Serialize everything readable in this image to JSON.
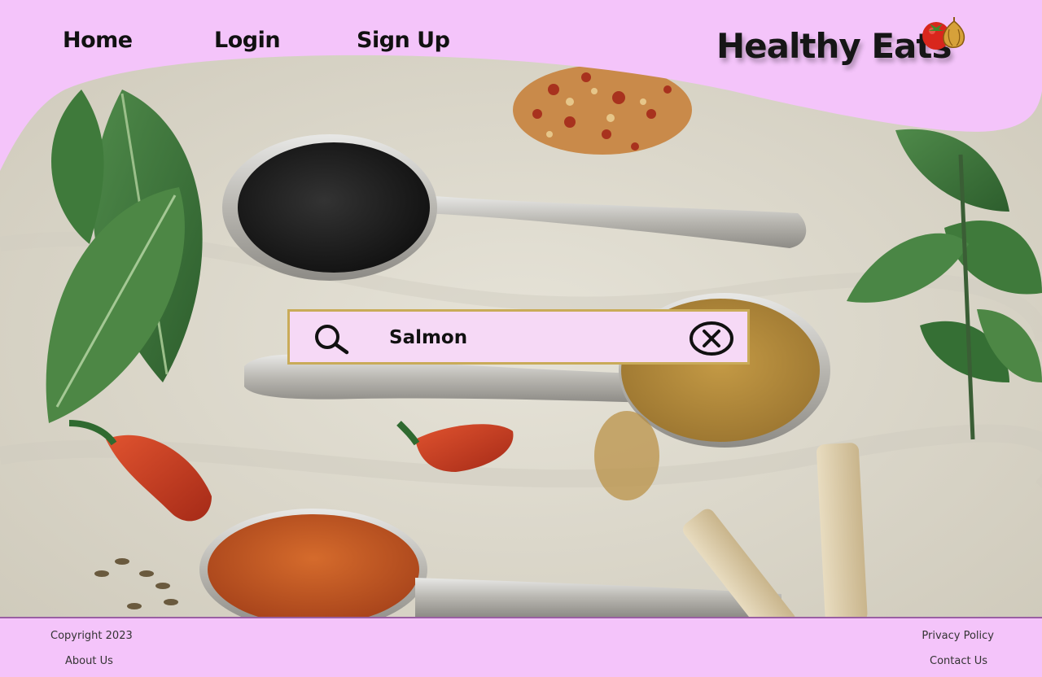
{
  "nav": {
    "home": "Home",
    "login": "Login",
    "signup": "Sign Up"
  },
  "brand": {
    "name": "Healthy Eats",
    "logo_icon": "tomato-garlic-icon"
  },
  "search": {
    "value": "Salmon",
    "search_icon": "search-icon",
    "clear_icon": "clear-icon"
  },
  "hero": {
    "image": "spices-on-spoons-photo"
  },
  "footer": {
    "copyright": "Copyright 2023",
    "about": "About Us",
    "privacy": "Privacy Policy",
    "contact": "Contact Us"
  },
  "colors": {
    "pink": "#f4c4fa",
    "search_bg": "#f6d9f6",
    "search_border": "#c9ab58",
    "footer_border": "#9a5fa3"
  }
}
